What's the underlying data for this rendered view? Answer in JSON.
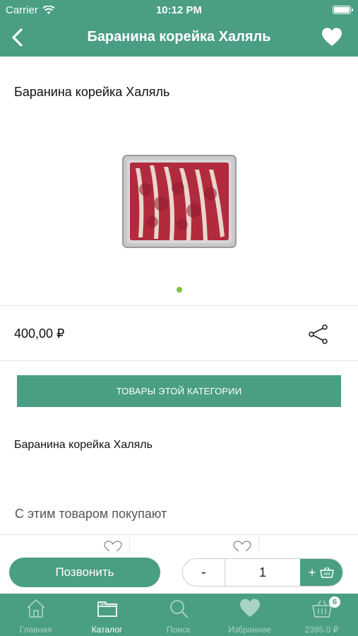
{
  "status_bar": {
    "carrier": "Carrier",
    "time": "10:12 PM"
  },
  "nav": {
    "title": "Баранина корейка Халяль"
  },
  "product": {
    "title": "Баранина корейка Халяль",
    "image_icon": "lamb-rack-photo",
    "price": "400,00 ₽",
    "description": "Баранина корейка Халяль",
    "image_pager": {
      "count": 1,
      "active": 1
    }
  },
  "category_button": {
    "label": "ТОВАРЫ ЭТОЙ КАТЕГОРИИ"
  },
  "related": {
    "heading": "С этим товаром покупают"
  },
  "actions": {
    "call_label": "Позвонить",
    "minus": "-",
    "quantity": "1",
    "plus": "+"
  },
  "tabbar": {
    "items": [
      {
        "label": "Главная",
        "icon": "home-icon"
      },
      {
        "label": "Каталог",
        "icon": "catalog-folder-icon",
        "active": true
      },
      {
        "label": "Поиск",
        "icon": "search-icon"
      },
      {
        "label": "Избранное",
        "icon": "heart-icon"
      },
      {
        "label": "2395.0 ₽",
        "icon": "basket-icon",
        "badge": "6"
      }
    ]
  },
  "colors": {
    "accent": "#4a9e84",
    "pager_dot": "#7cc242"
  }
}
